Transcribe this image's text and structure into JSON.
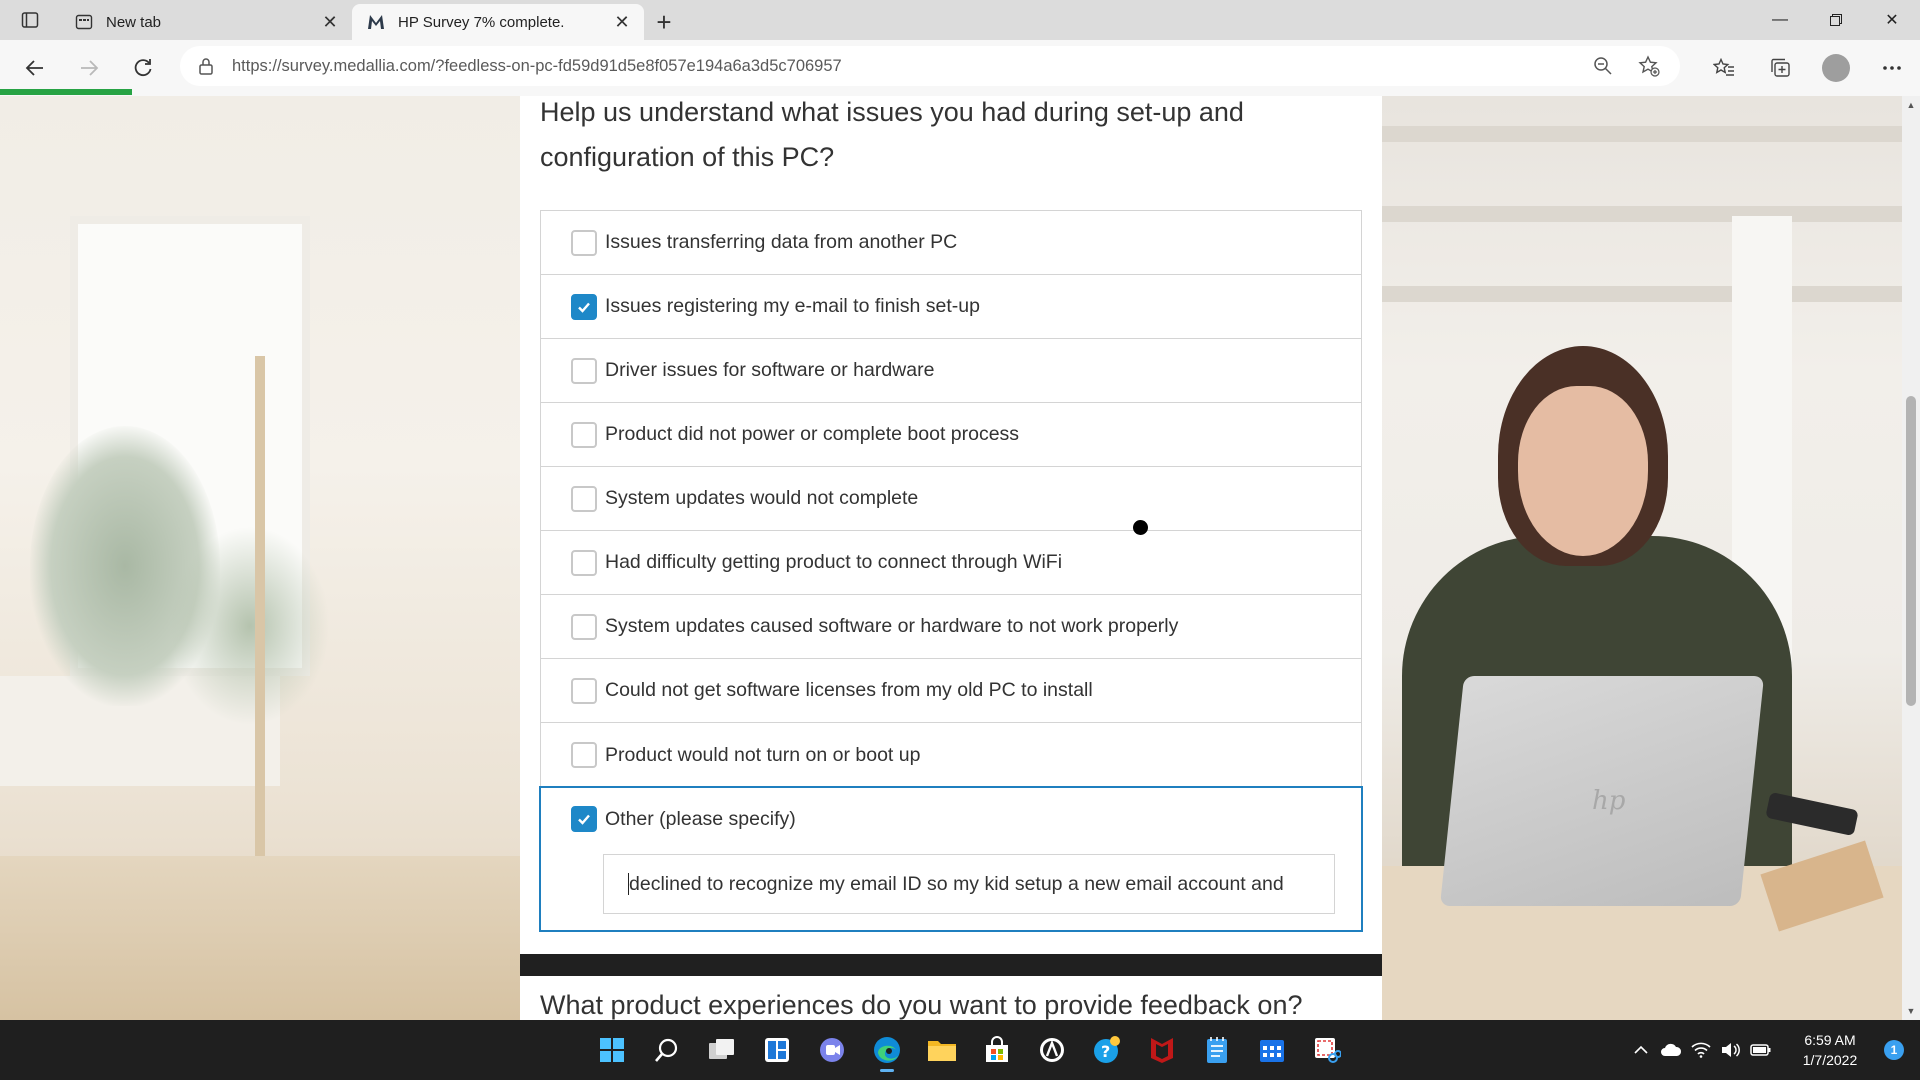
{
  "browser": {
    "tabs": [
      {
        "title": "New tab",
        "icon": "newtab-icon",
        "active": false
      },
      {
        "title": "HP Survey 7% complete.",
        "icon": "medallia-m-icon",
        "active": true
      }
    ],
    "url": "https://survey.medallia.com/?feedless-on-pc-fd59d91d5e8f057e194a6a3d5c706957",
    "load_progress_visible": true
  },
  "survey": {
    "question": "Help us understand what issues you had during set-up and configuration of this PC?",
    "options": [
      {
        "label": "Issues transferring data from another PC",
        "checked": false
      },
      {
        "label": "Issues registering my e-mail to finish set-up",
        "checked": true
      },
      {
        "label": "Driver issues for software or hardware",
        "checked": false
      },
      {
        "label": "Product did not power or complete boot process",
        "checked": false
      },
      {
        "label": "System updates would not complete",
        "checked": false
      },
      {
        "label": "Had difficulty getting product to connect through WiFi",
        "checked": false
      },
      {
        "label": "System updates caused software or hardware to not work properly",
        "checked": false
      },
      {
        "label": "Could not get software licenses from my old PC to install",
        "checked": false
      },
      {
        "label": "Product would not turn on or boot up",
        "checked": false
      }
    ],
    "other": {
      "label": "Other (please specify)",
      "checked": true,
      "value": "declined to recognize my email ID so my kid setup a new email account and"
    },
    "next_question": "What product experiences do you want to provide feedback on?"
  },
  "taskbar": {
    "apps": [
      "windows-start-icon",
      "search-icon",
      "task-view-icon",
      "widgets-icon",
      "teams-chat-icon",
      "edge-icon",
      "file-explorer-icon",
      "store-icon",
      "app-circle-icon",
      "help-icon",
      "mcafee-icon",
      "notepad-icon",
      "calendar-icon",
      "snipping-icon"
    ],
    "time": "6:59 AM",
    "date": "1/7/2022",
    "notification_count": "1"
  },
  "colors": {
    "accent": "#1e88c8",
    "other_border": "#1f7fbf",
    "progress": "#27a344"
  }
}
